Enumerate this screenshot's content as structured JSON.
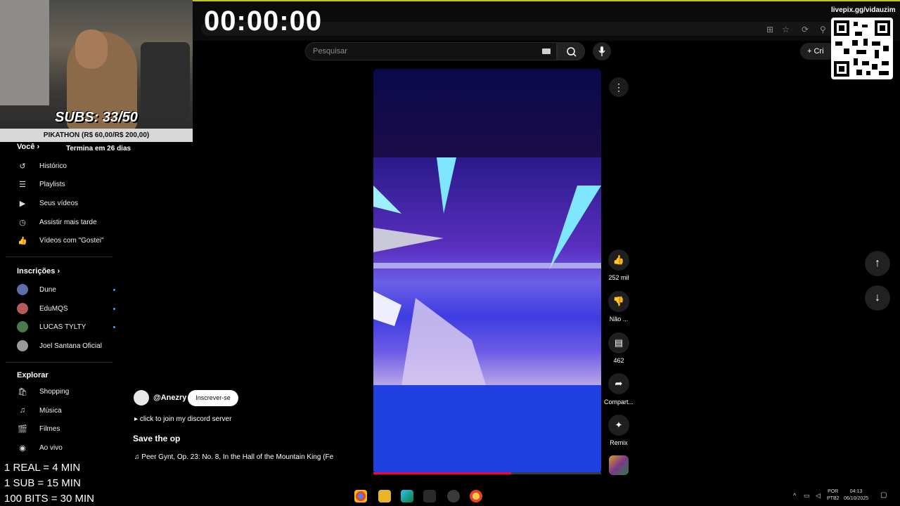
{
  "stream": {
    "timer": "00:00:00",
    "livepix_url": "livepix.gg/vidauzim",
    "subs_goal": "SUBS: 33/50",
    "pikathon": "PIKATHON (R$ 60,00/R$ 200,00)",
    "termina": "Termina em 26 dias",
    "overlay_lines": [
      "1 REAL = 4 MIN",
      "1 SUB = 15 MIN",
      "100 BITS = 30 MIN"
    ]
  },
  "header": {
    "search_placeholder": "Pesquisar",
    "create_label": "Cri"
  },
  "sidebar": {
    "voce_label": "Você",
    "voce_items": [
      {
        "label": "Histórico",
        "icon": "history-icon"
      },
      {
        "label": "Playlists",
        "icon": "playlists-icon"
      },
      {
        "label": "Seus vídeos",
        "icon": "your-videos-icon"
      },
      {
        "label": "Assistir mais tarde",
        "icon": "watch-later-icon"
      },
      {
        "label": "Vídeos com \"Gostei\"",
        "icon": "liked-icon"
      }
    ],
    "inscricoes_label": "Inscrições",
    "subscriptions": [
      {
        "label": "Dune",
        "color": "#5b6fa8"
      },
      {
        "label": "EduMQS",
        "color": "#b45a5a"
      },
      {
        "label": "LUCAS TYLTY",
        "color": "#4a7a4a"
      },
      {
        "label": "Joel Santana Oficial",
        "color": "#9a9a9a"
      }
    ],
    "explorar_label": "Explorar",
    "explore_items": [
      {
        "label": "Shopping",
        "icon": "shopping-icon"
      },
      {
        "label": "Música",
        "icon": "music-icon"
      },
      {
        "label": "Filmes",
        "icon": "movies-icon"
      },
      {
        "label": "Ao vivo",
        "icon": "live-icon"
      }
    ]
  },
  "short": {
    "channel": "@Anezry",
    "subscribe_label": "Inscrever-se",
    "description": "click to join my discord server",
    "title": "Save the op",
    "music": "Peer Gynt, Op. 23: No. 8, In the Hall of the Mountain King (Fe"
  },
  "actions": {
    "likes": "252 mil",
    "dislike": "Não ...",
    "comments": "462",
    "share": "Compart...",
    "remix": "Remix"
  },
  "taskbar": {
    "lang": "POR",
    "layout": "PTB2",
    "time": "04:13",
    "date": "06/10/2025"
  },
  "colors": {
    "accent": "#3ea6ff",
    "progress": "#ff0033",
    "stream_bar": "#c9c21a"
  }
}
